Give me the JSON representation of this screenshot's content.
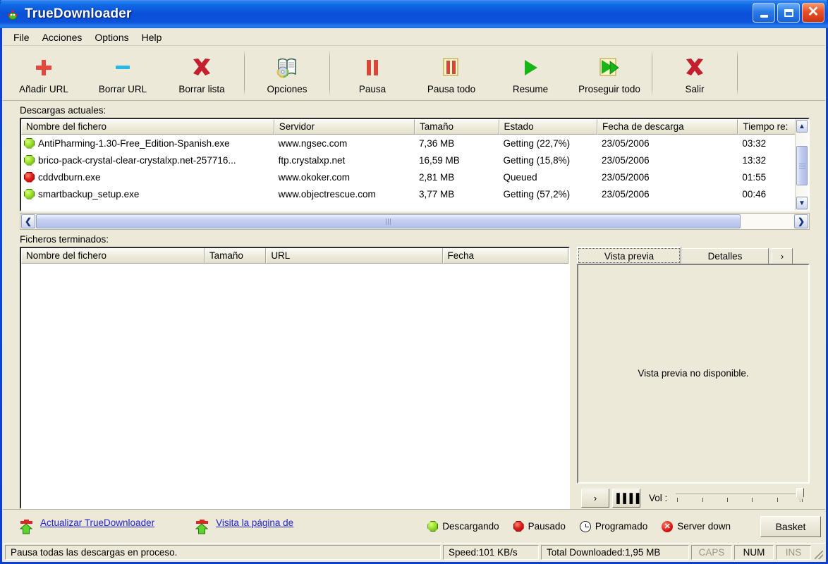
{
  "window": {
    "title": "TrueDownloader",
    "icon": "app-frog-icon",
    "buttons": {
      "minimize": "_",
      "maximize": "□",
      "close": "✕"
    }
  },
  "menu": {
    "items": [
      "File",
      "Acciones",
      "Options",
      "Help"
    ]
  },
  "toolbar": {
    "groups": [
      {
        "buttons": [
          {
            "label": "Añadir URL",
            "icon": "plus-icon"
          },
          {
            "label": "Borrar URL",
            "icon": "minus-icon"
          },
          {
            "label": "Borrar lista",
            "icon": "red-x-icon"
          }
        ]
      },
      {
        "buttons": [
          {
            "label": "Opciones",
            "icon": "book-cd-icon"
          }
        ]
      },
      {
        "buttons": [
          {
            "label": "Pausa",
            "icon": "pause-icon"
          },
          {
            "label": "Pausa todo",
            "icon": "pause-all-icon"
          },
          {
            "label": "Resume",
            "icon": "play-icon"
          },
          {
            "label": "Proseguir todo",
            "icon": "play-all-icon"
          }
        ]
      },
      {
        "buttons": [
          {
            "label": "Salir",
            "icon": "exit-x-icon"
          }
        ]
      }
    ]
  },
  "current_downloads": {
    "section_label": "Descargas actuales:",
    "columns": [
      "Nombre del fichero",
      "Servidor",
      "Tamaño",
      "Estado",
      "Fecha de descarga",
      "Tiempo re:"
    ],
    "rows": [
      {
        "status": "downloading",
        "name": "AntiPharming-1.30-Free_Edition-Spanish.exe",
        "server": "www.ngsec.com",
        "size": "7,36 MB",
        "state": "Getting (22,7%)",
        "date": "23/05/2006",
        "remaining": "03:32"
      },
      {
        "status": "downloading",
        "name": "brico-pack-crystal-clear-crystalxp.net-257716...",
        "server": "ftp.crystalxp.net",
        "size": "16,59 MB",
        "state": "Getting (15,8%)",
        "date": "23/05/2006",
        "remaining": "13:32"
      },
      {
        "status": "paused",
        "name": "cddvdburn.exe",
        "server": "www.okoker.com",
        "size": "2,81 MB",
        "state": "Queued",
        "date": "23/05/2006",
        "remaining": "01:55"
      },
      {
        "status": "downloading",
        "name": "smartbackup_setup.exe",
        "server": "www.objectrescue.com",
        "size": "3,77 MB",
        "state": "Getting (57,2%)",
        "date": "23/05/2006",
        "remaining": "00:46"
      }
    ]
  },
  "finished_files": {
    "section_label": "Ficheros terminados:",
    "columns": [
      "Nombre del fichero",
      "Tamaño",
      "URL",
      "Fecha"
    ],
    "rows": []
  },
  "side_panel": {
    "tabs": [
      {
        "label": "Vista previa",
        "active": true
      },
      {
        "label": "Detalles",
        "active": false
      }
    ],
    "overflow_arrow": "›",
    "preview_message": "Vista previa no disponible.",
    "player": {
      "play_label": "›",
      "stop_label": "▐▐▐▐",
      "volume_label": "Vol :"
    }
  },
  "footer": {
    "links": [
      {
        "line1": "Actualizar TrueDownloader",
        "icon": "update-arrow-icon"
      },
      {
        "line1": "Visita la página de",
        "icon": "web-arrow-icon"
      }
    ],
    "legend": [
      {
        "label": "Descargando",
        "icon": "green-octagon-icon",
        "color": "#9ee032"
      },
      {
        "label": "Pausado",
        "icon": "red-octagon-icon",
        "color": "#e02020"
      },
      {
        "label": "Programado",
        "icon": "clock-icon",
        "color": "#ffffff"
      },
      {
        "label": "Server down",
        "icon": "red-x-circle-icon",
        "color": "#d81616"
      }
    ],
    "basket_label": "Basket"
  },
  "statusbar": {
    "hint": "Pausa todas las descargas en proceso.",
    "speed": "Speed:101 KB/s",
    "total": "Total Downloaded:1,95 MB",
    "caps": "CAPS",
    "num": "NUM",
    "ins": "INS"
  },
  "colors": {
    "titlebar_blue": "#0a46e0",
    "face": "#ece9d8",
    "link": "#2222cc",
    "accent_red": "#cc2222",
    "accent_green": "#22a822"
  }
}
